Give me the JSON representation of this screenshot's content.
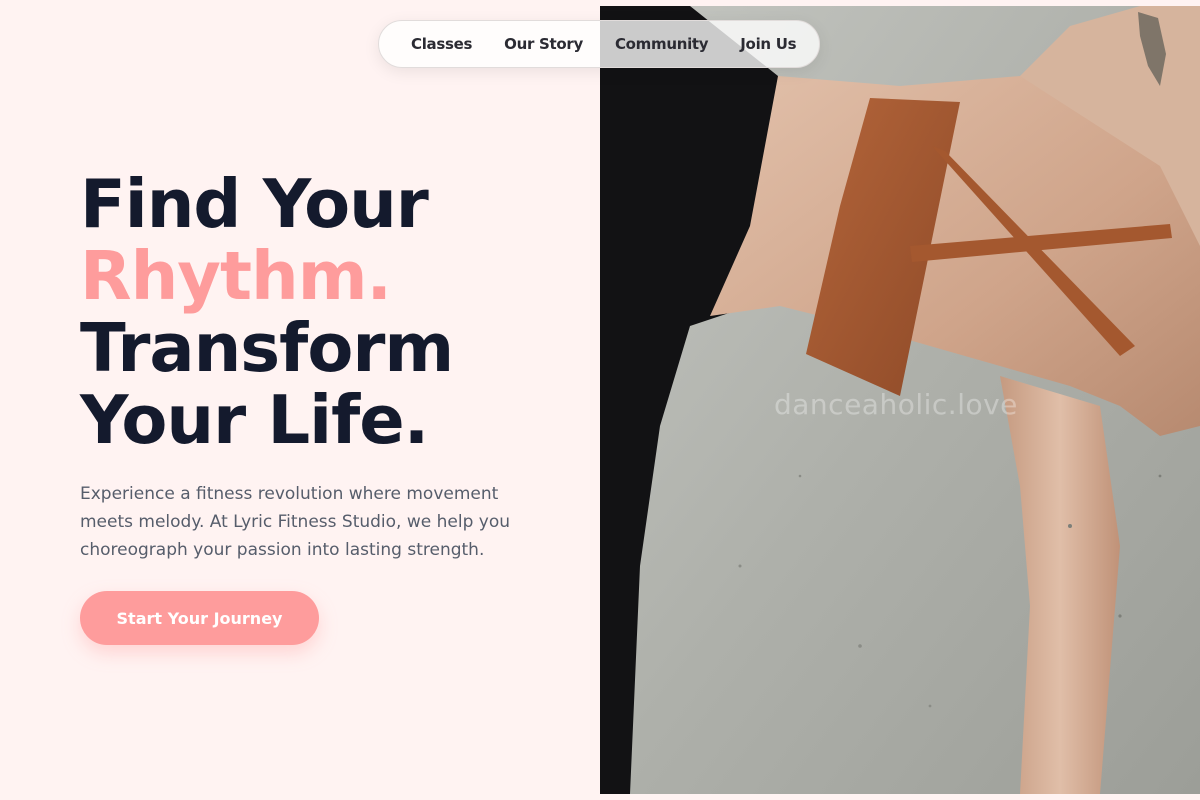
{
  "nav": {
    "items": [
      {
        "label": "Classes"
      },
      {
        "label": "Our Story"
      },
      {
        "label": "Community"
      },
      {
        "label": "Join Us"
      }
    ]
  },
  "hero": {
    "headline_line1": "Find Your",
    "headline_line2": "Rhythm.",
    "headline_line3": "Transform",
    "headline_line4": "Your Life.",
    "description": "Experience a fitness revolution where movement meets melody. At Lyric Fitness Studio, we help you choreograph your passion into lasting strength.",
    "cta_label": "Start Your Journey"
  },
  "photo": {
    "watermark": "danceaholic.love"
  },
  "colors": {
    "background": "#fff3f2",
    "accent": "#fe9c9c",
    "heading": "#141a2d",
    "body_text": "#565d6b"
  }
}
